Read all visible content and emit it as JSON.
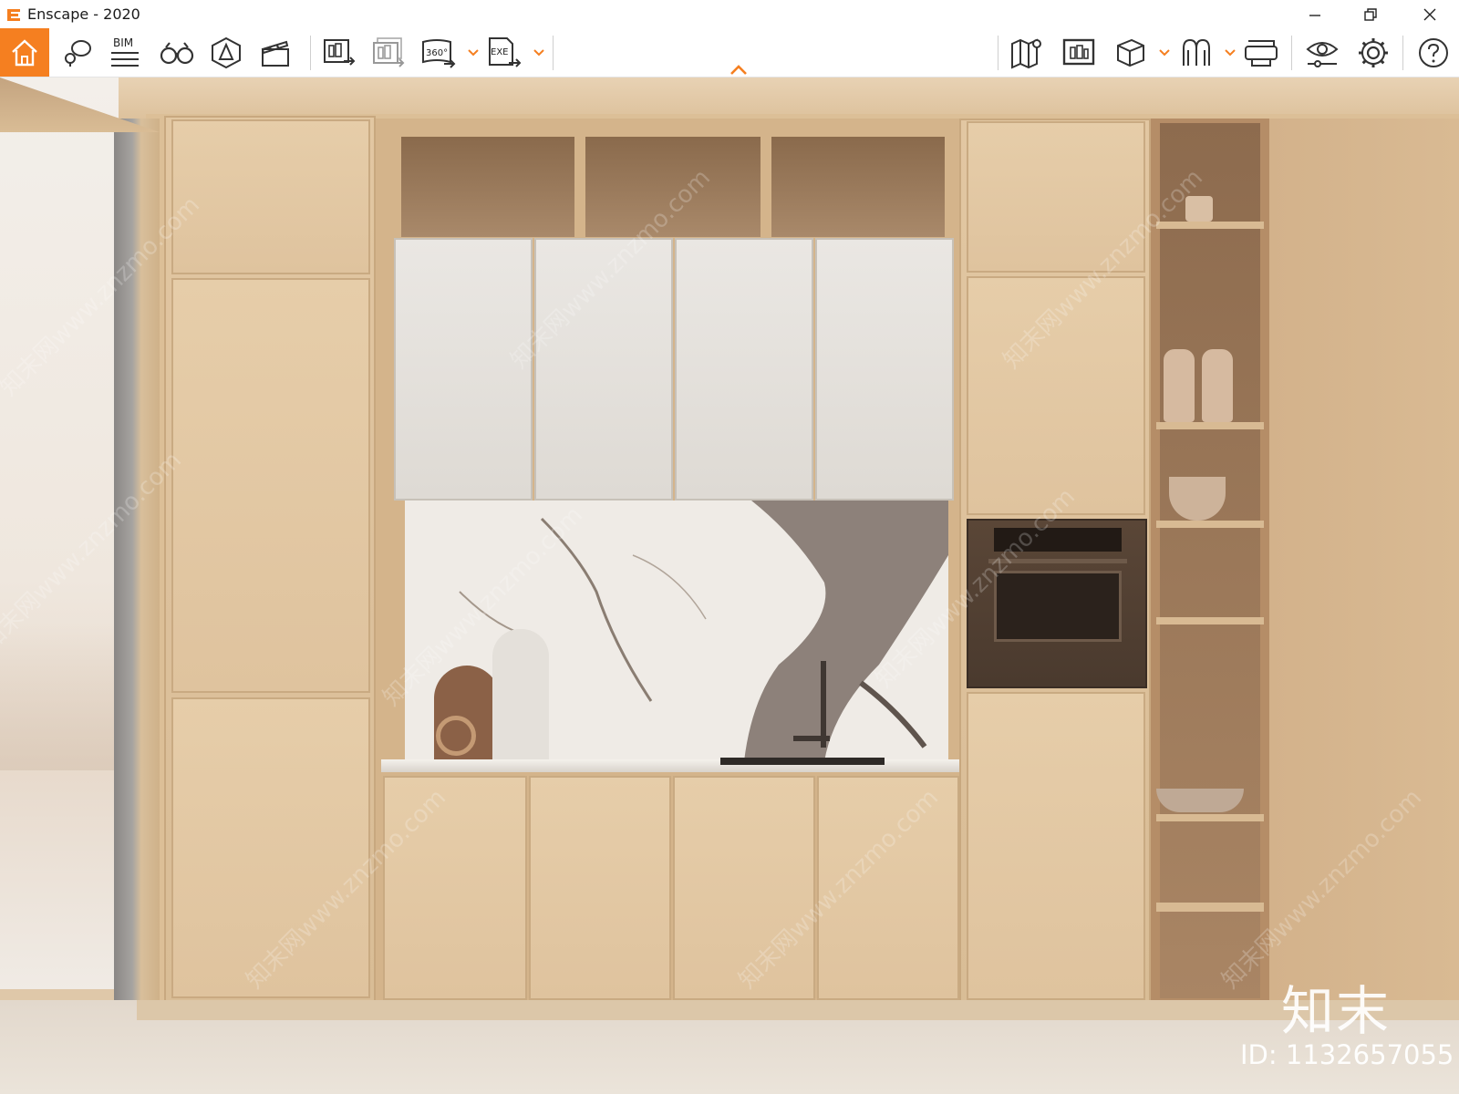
{
  "window": {
    "title": "Enscape - 2020",
    "accent_color": "#f57f20"
  },
  "toolbar": {
    "home_icon": "home-icon",
    "bim_label": "BIM",
    "panorama_label": "360°",
    "exe_label": "EXE",
    "items": [
      "home-icon",
      "location-pin-icon",
      "bim-icon",
      "binoculars-icon",
      "asset-library-icon",
      "video-clapper-icon",
      "export-image-icon",
      "batch-render-icon",
      "panorama-icon",
      "exe-export-icon",
      "map-icon",
      "screenshot-icon",
      "view-cube-icon",
      "atmosphere-icon",
      "vr-headset-icon",
      "visual-settings-icon",
      "gear-icon",
      "help-icon"
    ]
  },
  "watermark": {
    "site_text": "知末网www.znzmo.com",
    "brand": "知末",
    "id_text": "ID: 1132657055"
  }
}
